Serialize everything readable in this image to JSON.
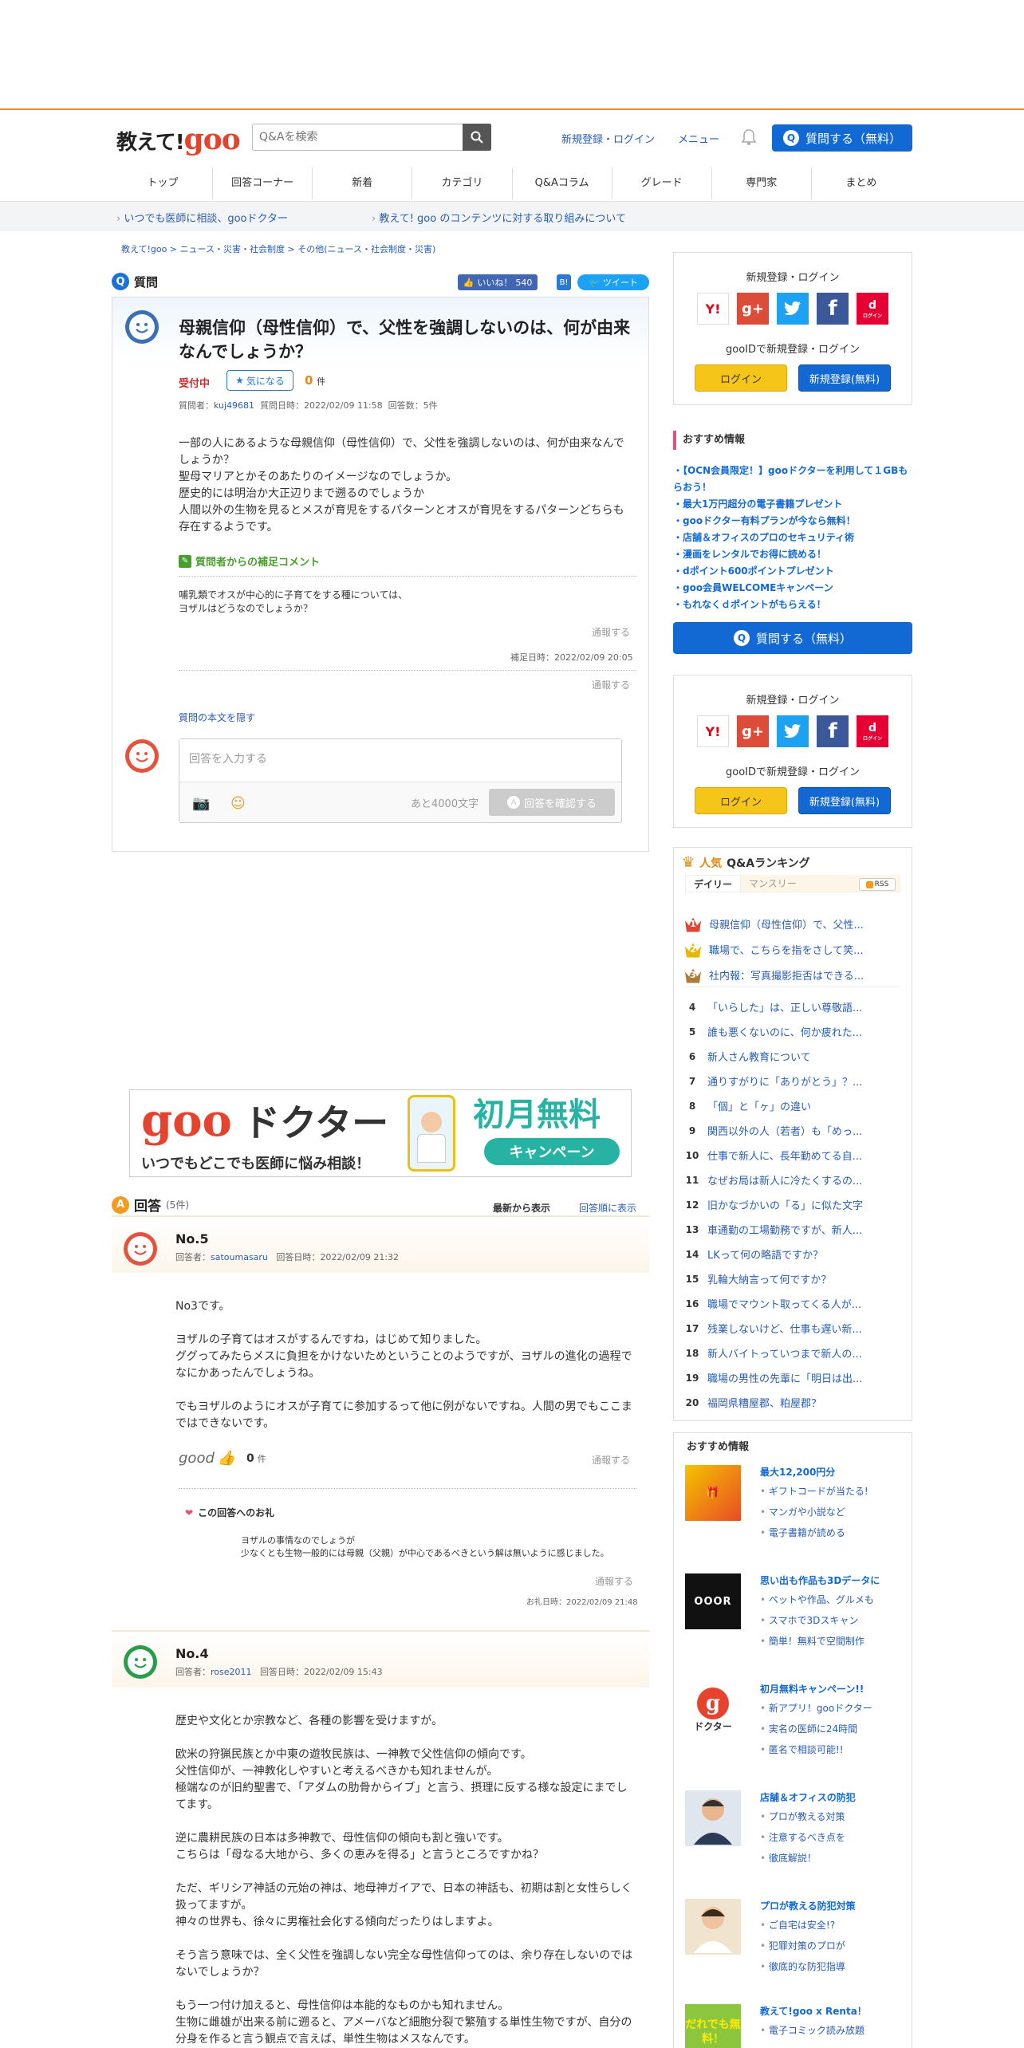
{
  "header": {
    "logo_text": "教えて!",
    "logo_goo": "goo",
    "search_placeholder": "Q&Aを検索",
    "register_login": "新規登録・ログイン",
    "menu": "メニュー",
    "ask_button": "質問する（無料）",
    "nav": [
      "トップ",
      "回答コーナー",
      "新着",
      "カテゴリ",
      "Q&Aコラム",
      "グレード",
      "専門家",
      "まとめ"
    ]
  },
  "infobar": {
    "left": "いつでも医師に相談、gooドクター",
    "right": "教えて! goo のコンテンツに対する取り組みについて"
  },
  "breadcrumb": [
    "教えて!goo",
    "ニュース・災害・社会制度",
    "その他(ニュース・社会制度・災害)"
  ],
  "question": {
    "section_label": "質問",
    "like_label": "いいね！",
    "like_count": "540",
    "tweet_label": "ツイート",
    "title": "母親信仰（母性信仰）で、父性を強調しないのは、何が由来なんでしょうか？",
    "status": "受付中",
    "kininaru": "気になる",
    "kininaru_count": "0",
    "kininaru_unit": "件",
    "meta_prefix": "質問者：",
    "user": "kuj49681",
    "date": "質問日時：2022/02/09 11:58",
    "answer_count": "回答数：5件",
    "body": [
      "一部の人にあるような母親信仰（母性信仰）で、父性を強調しないのは、何が由来なんでしょうか？",
      "聖母マリアとかそのあたりのイメージなのでしょうか。",
      "歴史的には明治か大正辺りまで遡るのでしょうか",
      "人間以外の生物を見るとメスが育児をするパターンとオスが育児をするパターンどちらも存在するようです。"
    ],
    "supplement_label": "質問者からの補足コメント",
    "supplement": [
      "哺乳類でオスが中心的に子育てをする種については、",
      "ヨザルはどうなのでしょうか？"
    ],
    "report": "通報する",
    "supplement_date": "補足日時：2022/02/09 20:05",
    "hide_body": "質問の本文を隠す",
    "answer_placeholder": "回答を入力する",
    "remaining": "あと4000文字",
    "confirm": "回答を確認する"
  },
  "banner": {
    "goo": "goo",
    "doctor": "ドクター",
    "tagline": "いつでもどこでも医師に悩み相談！",
    "free": "初月無料",
    "campaign": "キャンペーン"
  },
  "answers_header": {
    "label": "回答",
    "count": "(5件)",
    "sort_new": "最新から表示",
    "sort_old": "回答順に表示"
  },
  "answers": [
    {
      "no": "No.5",
      "meta_prefix": "回答者：",
      "user": "satoumasaru",
      "date": "回答日時：2022/02/09 21:32",
      "body": [
        "No3です。",
        "",
        "ヨザルの子育てはオスがするんですね，はじめて知りました。",
        "ググってみたらメスに負担をかけないためということのようですが、ヨザルの進化の過程でなにかあったんでしょうね。",
        "",
        "でもヨザルのようにオスが子育てに参加するって他に例がないですね。人間の男でもここまではできないです。"
      ],
      "good": "good",
      "good_count": "0",
      "good_unit": "件",
      "report": "通報する",
      "thanks_label": "この回答へのお礼",
      "thanks_body": [
        "ヨザルの事情なのでしょうが",
        "少なくとも生物一般的には母親（父親）が中心であるべきという解は無いように感じました。"
      ],
      "thanks_date": "お礼日時：2022/02/09 21:48"
    },
    {
      "no": "No.4",
      "meta_prefix": "回答者：",
      "user": "rose2011",
      "date": "回答日時：2022/02/09 15:43",
      "body": [
        "歴史や文化とか宗教など、各種の影響を受けますが。",
        "",
        "欧米の狩猟民族とか中東の遊牧民族は、一神教で父性信仰の傾向です。",
        "父性信仰が、一神教化しやすいと考えるべきかも知れませんが。",
        "極端なのが旧約聖書で、「アダムの肋骨からイブ」と言う、摂理に反する様な設定にまでしてます。",
        "",
        "逆に農耕民族の日本は多神教で、母性信仰の傾向も割と強いです。",
        "こちらは「母なる大地から、多くの恵みを得る」と言うところですかね？",
        "",
        "ただ、ギリシア神話の元始の神は、地母神ガイアで、日本の神話も、初期は割と女性らしく扱ってますが。",
        "神々の世界も、徐々に男権社会化する傾向だったりはしますよ。",
        "",
        "そう言う意味では、全く父性を強調しない完全な母性信仰ってのは、余り存在しないのではないでしょうか？",
        "",
        "もう一つ付け加えると、母性信仰は本能的なものかも知れません。",
        "生物に雌雄が出来る前に遡ると、アメーバなど細胞分裂で繁殖する単性生物ですが、自分の分身を作ると言う観点で言えば、単性生物はメスなんです。"
      ]
    }
  ],
  "sidebar": {
    "login_title": "新規登録・ログイン",
    "gooid_title": "gooIDで新規登録・ログイン",
    "login_btn": "ログイン",
    "register_btn": "新規登録(無料)",
    "sns": [
      "Y!",
      "g+",
      "twitter",
      "f",
      "d"
    ],
    "docomo_label": "ログイン",
    "recommend_title": "おすすめ情報",
    "recommend": [
      "・【OCN会員限定！】gooドクターを利用して１GBもらおう！",
      "・最大1万円超分の電子書籍プレゼント",
      "・gooドクター有料プランが今なら無料！",
      "・店舗＆オフィスのプロのセキュリティ術",
      "・漫画をレンタルでお得に読める！",
      "・dポイント600ポイントプレゼント",
      "・goo会員WELCOMEキャンペーン",
      "・もれなくｄポイントがもらえる！"
    ],
    "ask_button": "質問する（無料）",
    "ranking": {
      "title_pop": "人気",
      "title_rest": "Q&Aランキング",
      "tab_daily": "デイリー",
      "tab_monthly": "マンスリー",
      "rss": "RSS",
      "items": [
        "母親信仰（母性信仰）で、父性...",
        "職場で、こちらを指をさして笑...",
        "社内報：写真撮影拒否はできる...",
        "「いらした」は、正しい尊敬語...",
        "誰も悪くないのに、何か疲れた...",
        "新人さん教育について",
        "通りすがりに「ありがとう」？...",
        "「個」と「ヶ」の違い",
        "関西以外の人（若者）も「めっ...",
        "仕事で新人に、長年勤めてる自...",
        "なぜお局は新人に冷たくするの...",
        "旧かなづかいの「る」に似た文字",
        "車通勤の工場勤務ですが、新人...",
        "LKって何の略語ですか？",
        "乳輪大納言って何ですか？",
        "職場でマウント取ってくる人が...",
        "残業しないけど、仕事も遅い新...",
        "新人バイトっていつまで新人の...",
        "職場の男性の先輩に「明日は出...",
        "福岡県糟屋郡、粕屋郡？"
      ]
    },
    "osusume": {
      "title": "おすすめ情報",
      "items": [
        {
          "head": "最大12,200円分",
          "subs": [
            "ギフトコードが当たる!",
            "マンガや小説など",
            "電子書籍が読める"
          ],
          "thumb": ""
        },
        {
          "head": "思い出も作品も3Dデータに",
          "subs": [
            "ペットや作品、グルメも",
            "スマホで3Dスキャン",
            "簡単！無料で空間制作"
          ],
          "thumb": "OOOR"
        },
        {
          "head": "初月無料キャンペーン!!",
          "subs": [
            "新アプリ！gooドクター",
            "実名の医師に24時間",
            "匿名で相談可能!!"
          ],
          "thumb": "ドクター"
        },
        {
          "head": "店舗＆オフィスの防犯",
          "subs": [
            "プロが教える対策",
            "注意するべき点を",
            "徹底解説！"
          ],
          "thumb": ""
        },
        {
          "head": "プロが教える防犯対策",
          "subs": [
            "ご自宅は安全!?",
            "犯罪対策のプロが",
            "徹底的な防犯指導"
          ],
          "thumb": ""
        },
        {
          "head": "教えて!goo x Renta！",
          "subs": [
            "電子コミック読み放題"
          ],
          "thumb": "だれでも無料！"
        }
      ]
    }
  }
}
